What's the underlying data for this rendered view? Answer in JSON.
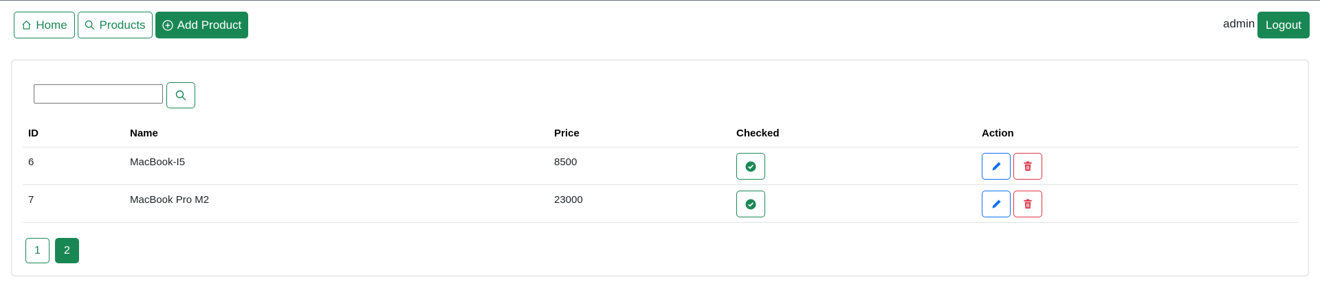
{
  "nav": {
    "home_label": "Home",
    "products_label": "Products",
    "add_label": "Add Product",
    "username": "admin",
    "logout_label": "Logout"
  },
  "search": {
    "value": "",
    "placeholder": ""
  },
  "table": {
    "headers": [
      "ID",
      "Name",
      "Price",
      "Checked",
      "Action"
    ],
    "rows": [
      {
        "id": "6",
        "name": "MacBook-I5",
        "price": "8500",
        "checked": true
      },
      {
        "id": "7",
        "name": "MacBook Pro M2",
        "price": "23000",
        "checked": true
      }
    ]
  },
  "pagination": {
    "pages": [
      "1",
      "2"
    ],
    "current": "2"
  },
  "colors": {
    "success": "#198754",
    "primary": "#0d6efd",
    "danger": "#dc3545"
  },
  "icons": {
    "home": "house-icon",
    "products": "search-icon",
    "add": "plus-circle-icon",
    "checked": "check-circle-icon",
    "edit": "pencil-icon",
    "delete": "trash-icon"
  }
}
